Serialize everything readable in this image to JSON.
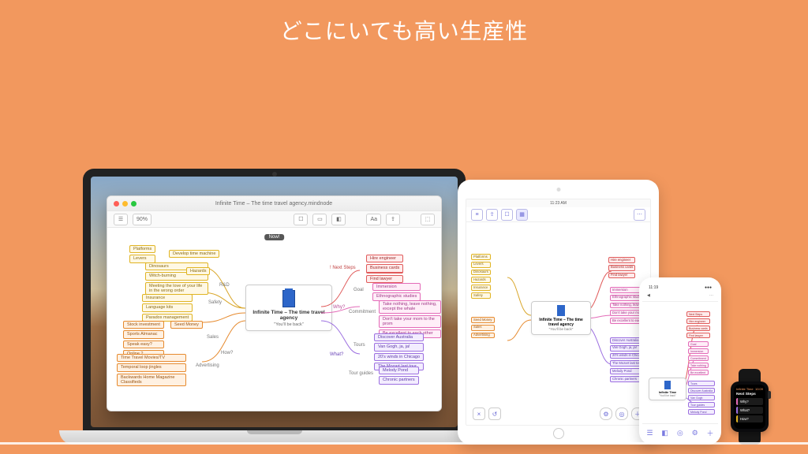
{
  "headline": "どこにいても高い生産性",
  "mac": {
    "window_title": "Infinite Time – The time travel agency.mindnode",
    "zoom": "90%",
    "now_tag": "Now!",
    "center_title": "Infinite Time – The time travel agency",
    "center_subtitle": "\"You'll be back\"",
    "left_groups": {
      "rnd": {
        "label": "R&D",
        "items": [
          "Platforms",
          "Levers",
          "Dinosaurs",
          "Witch-burning",
          "Meeting the love of your life in the wrong order"
        ],
        "extra": [
          "Develop time machine",
          "Hazards"
        ]
      },
      "safety": {
        "label": "Safety",
        "items": [
          "Insurance",
          "Language kits",
          "Paradox management"
        ]
      },
      "sales": {
        "label": "Sales",
        "items": [
          "Stock investment",
          "Sports Almanac",
          "Speak easy?",
          "Online ?"
        ],
        "extra": [
          "Seed Money"
        ]
      },
      "ads": {
        "label": "Advertising",
        "items": [
          "Time Travel Movies/TV",
          "Temporal loop jingles",
          "Backwards Home Magazine Classifieds"
        ]
      },
      "how": {
        "label": "How?"
      }
    },
    "right_groups": {
      "next": {
        "label": "! Next Steps",
        "items": [
          "Hire engineer",
          "Business cards",
          "Find lawyer"
        ]
      },
      "why": {
        "label": "Why?",
        "sub": [
          {
            "label": "Goal",
            "items": [
              "Immersion",
              "Ethnographic studies"
            ]
          },
          {
            "label": "Commitment",
            "items": [
              "Take nothing, leave nothing, except the whale",
              "Don't take your mom to the prom",
              "Be excellent to each other"
            ]
          }
        ]
      },
      "what": {
        "label": "What?",
        "sub": [
          {
            "label": "Tours",
            "items": [
              "Discover Australia",
              "Van Gogh, ja, ja!",
              "20's winds in Chicago",
              "The Mozart last tour"
            ]
          },
          {
            "label": "Tour guides",
            "items": [
              "Melody Pond",
              "Chronic partners"
            ]
          }
        ]
      }
    }
  },
  "ipad": {
    "time": "11:23 AM",
    "center_title": "Infinite Time – The time travel agency",
    "center_subtitle": "\"You'll be back\"",
    "right_samples": [
      "Hire engineer",
      "Business cards",
      "Find lawyer",
      "Immersion",
      "Ethnographic studies",
      "Take nothing, leave nothing",
      "Don't take your mom",
      "Be excellent to each other",
      "Discover Australia",
      "Van Gogh, ja, ja!",
      "20's winds in Chicago",
      "The Mozart last tour",
      "Melody Pond",
      "Chronic partners"
    ],
    "left_samples": [
      "Platforms",
      "Levers",
      "Dinosaurs",
      "Hazards",
      "Insurance",
      "Safety",
      "Seed Money",
      "Sales",
      "Advertising"
    ]
  },
  "iphone": {
    "time": "11:19",
    "title_left": "◀",
    "title_right": "⋯",
    "center_title": "Infinite Time",
    "center_subtitle": "\"You'll be back\"",
    "right_samples": [
      "Next Steps",
      "Hire engineer",
      "Business cards",
      "Find lawyer",
      "Goal",
      "Immersion",
      "Commitment",
      "Take nothing",
      "Be excellent",
      "Tours",
      "Discover Australia",
      "Van Gogh",
      "Tour guides",
      "Melody Pond"
    ]
  },
  "watch": {
    "back": "Infinite Time",
    "time": "10:09",
    "title": "Next Steps",
    "rows": [
      {
        "text": "Why?",
        "color": "#e36bb8"
      },
      {
        "text": "What?",
        "color": "#9c6fe0"
      },
      {
        "text": "How?",
        "color": "#e0b423"
      }
    ]
  }
}
